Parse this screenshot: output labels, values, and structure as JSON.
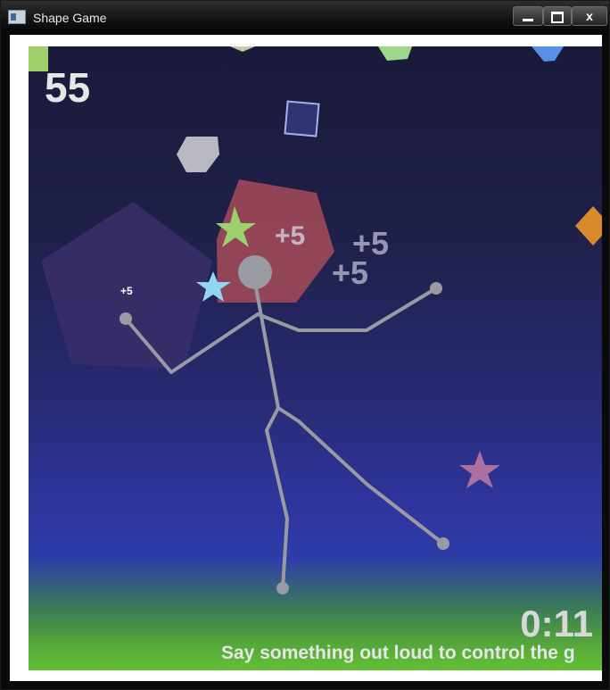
{
  "window": {
    "title": "Shape Game",
    "minimize_glyph": "",
    "maximize_glyph": "",
    "close_glyph": "x"
  },
  "hud": {
    "score": "55",
    "timer": "0:11",
    "prompt": "Say something out loud to control the g"
  },
  "popups": {
    "center": "+5",
    "right_upper": "+5",
    "right_lower": "+5",
    "small": "+5"
  },
  "shapes": [
    {
      "kind": "pentagon-large",
      "color": "#3a2f6a"
    },
    {
      "kind": "hexagon-red",
      "color": "#a24a58"
    },
    {
      "kind": "hexagon-gray",
      "color": "#b9b9c4"
    },
    {
      "kind": "square-outline",
      "color": "#6f7bd8"
    },
    {
      "kind": "star-green",
      "color": "#9ed16e"
    },
    {
      "kind": "star-cyan",
      "color": "#8fd6f5"
    },
    {
      "kind": "star-pink",
      "color": "#c47aa0"
    },
    {
      "kind": "diamond-orange",
      "color": "#d98a2a"
    },
    {
      "kind": "pentagon-green-top",
      "color": "#9ed68e"
    },
    {
      "kind": "square-green-corner",
      "color": "#9fcf6a"
    },
    {
      "kind": "blue-corner",
      "color": "#5a8fe8"
    }
  ],
  "player": {
    "color": "#9a9aa2"
  }
}
